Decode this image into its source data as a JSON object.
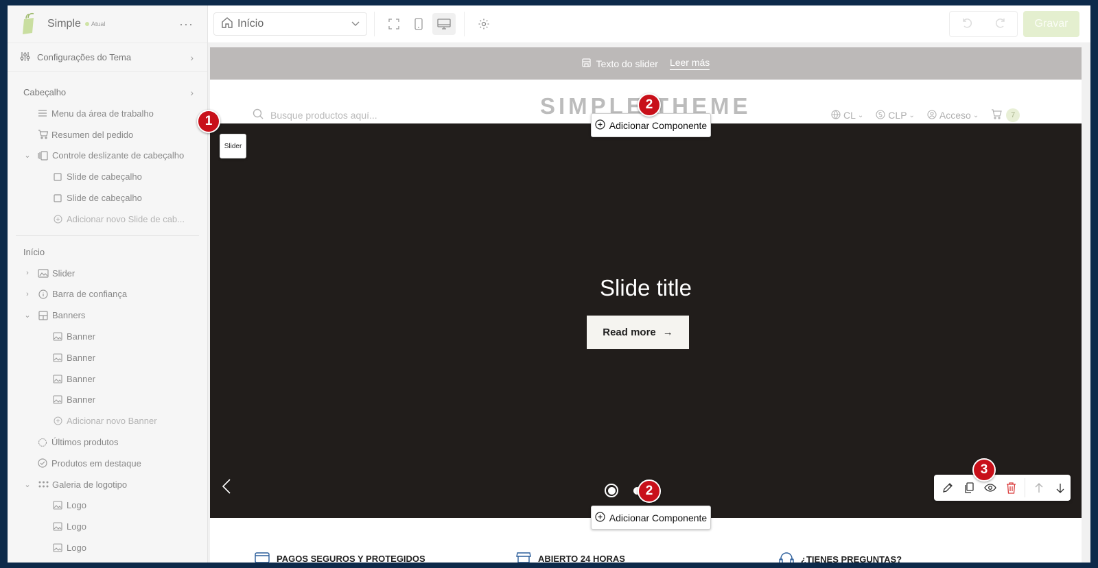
{
  "app": {
    "name": "Simple",
    "badge": "Atual"
  },
  "sidebar": {
    "theme_settings": "Configurações do Tema",
    "header_section": {
      "title": "Cabeçalho",
      "items": [
        {
          "label": "Menu da área de trabalho"
        },
        {
          "label": "Resumen del pedido"
        },
        {
          "label": "Controle deslizante de cabeçalho"
        },
        {
          "label": "Slide de cabeçalho"
        },
        {
          "label": "Slide de cabeçalho"
        },
        {
          "label": "Adicionar novo Slide de cab..."
        }
      ]
    },
    "home_section": {
      "title": "Início",
      "items": [
        {
          "label": "Slider"
        },
        {
          "label": "Barra de confiança"
        },
        {
          "label": "Banners"
        },
        {
          "label": "Banner"
        },
        {
          "label": "Banner"
        },
        {
          "label": "Banner"
        },
        {
          "label": "Banner"
        },
        {
          "label": "Adicionar novo Banner"
        },
        {
          "label": "Últimos produtos"
        },
        {
          "label": "Produtos em destaque"
        },
        {
          "label": "Galeria de logotipo"
        },
        {
          "label": "Logo"
        },
        {
          "label": "Logo"
        },
        {
          "label": "Logo"
        }
      ]
    }
  },
  "topbar": {
    "page": "Início",
    "save": "Gravar"
  },
  "preview": {
    "announcement": {
      "text": "Texto do slider",
      "link": "Leer más"
    },
    "search_placeholder": "Busque productos aquí...",
    "brand": "SIMPLE THEME",
    "country": "CL",
    "currency": "CLP",
    "account": "Acceso",
    "cart_count": "7",
    "slide_title": "Slide title",
    "read_more": "Read more",
    "trust": [
      "PAGOS SEGUROS Y PROTEGIDOS",
      "ABIERTO 24 HORAS",
      "¿TIENES PREGUNTAS?"
    ]
  },
  "overlay": {
    "slider_tag": "Slider",
    "add_component": "Adicionar Componente",
    "badges": [
      "1",
      "2",
      "2",
      "3"
    ]
  },
  "colors": {
    "accent_badge": "#c8101a",
    "save_bg": "#e4efcf",
    "hero_bg": "#211d1b"
  }
}
